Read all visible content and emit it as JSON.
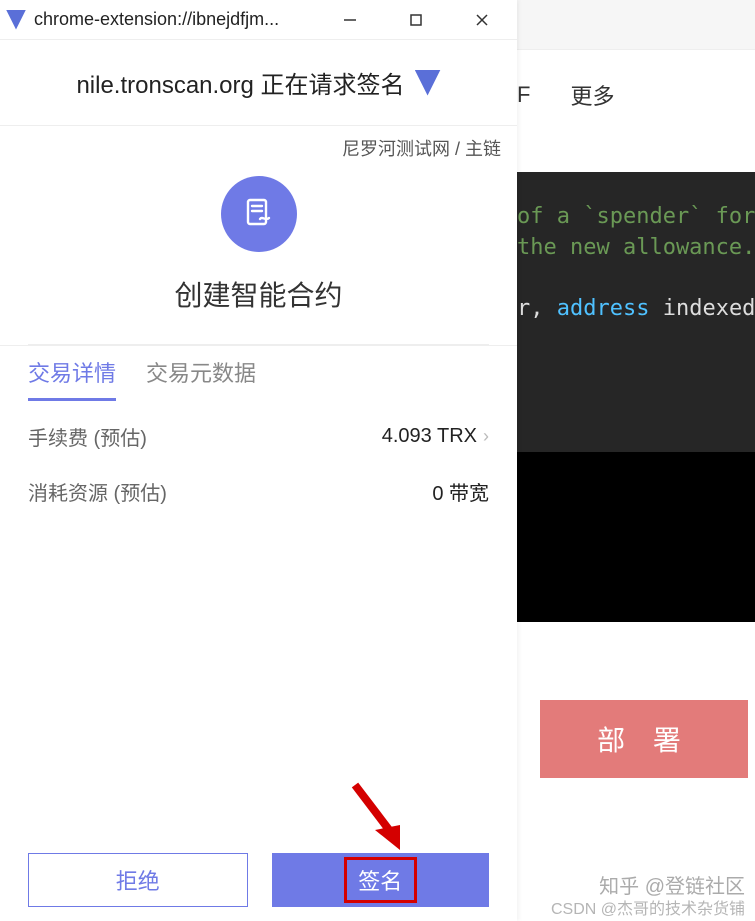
{
  "window": {
    "url": "chrome-extension://ibnejdfjm...",
    "min": "—",
    "max": "☐",
    "close": "✕"
  },
  "request": {
    "origin_text": "nile.tronscan.org 正在请求签名"
  },
  "network": {
    "label": "尼罗河测试网 / 主链"
  },
  "action": {
    "title": "创建智能合约"
  },
  "tabs": {
    "details": "交易详情",
    "metadata": "交易元数据"
  },
  "details": {
    "fee_label": "手续费 (预估)",
    "fee_value": "4.093 TRX",
    "resource_label": "消耗资源 (预估)",
    "resource_value": "0 带宽"
  },
  "footer": {
    "reject": "拒绝",
    "sign": "签名"
  },
  "background": {
    "nav_item1": "F",
    "nav_item2": "更多",
    "code_line1": "of a `spender` for an",
    "code_line2": "the new allowance.",
    "code_line3a": "r, ",
    "code_line3b": "address",
    "code_line3c": " indexed sp",
    "deploy": "部 署",
    "watermark1": "知乎 @登链社区",
    "watermark2": "CSDN @杰哥的技术杂货铺"
  }
}
